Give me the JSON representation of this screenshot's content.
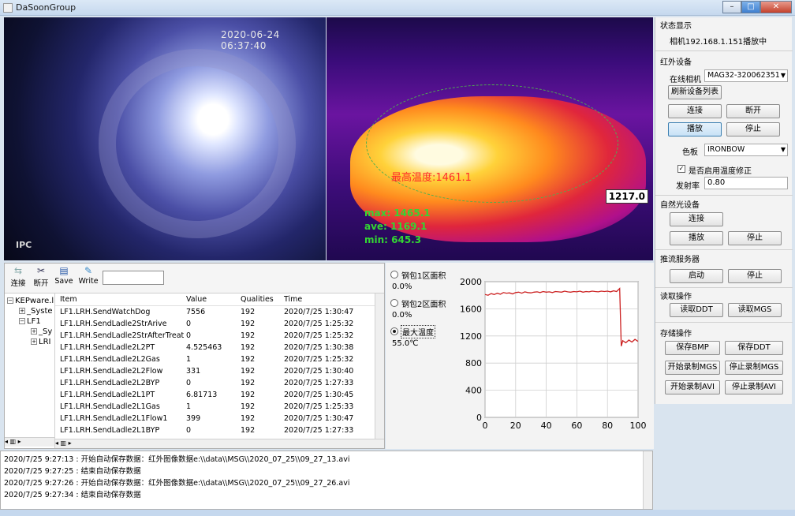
{
  "window": {
    "title": "DaSoonGroup"
  },
  "video": {
    "timestamp": "2020-06-24 06:37:40",
    "ipc_label": "IPC",
    "max_marker": "最高温度:1461.1",
    "stats_max": "max: 1465.1",
    "stats_ave": "ave: 1169.1",
    "stats_min": "min: 645.3",
    "point_temp": "1217.0"
  },
  "status": {
    "title": "状态显示",
    "text": "相机192.168.1.151播放中"
  },
  "infrared": {
    "title": "红外设备",
    "online_label": "在线相机",
    "camera_value": "MAG32-320062351",
    "refresh_label": "刷新设备列表",
    "connect_label": "连接",
    "disconnect_label": "断开",
    "play_label": "播放",
    "stop_label": "停止",
    "palette_label": "色板",
    "palette_value": "IRONBOW",
    "correction_label": "是否启用温度修正",
    "emissivity_label": "发射率",
    "emissivity_value": "0.80"
  },
  "natural": {
    "title": "自然光设备",
    "connect_label": "连接",
    "play_label": "播放",
    "stop_label": "停止"
  },
  "stream": {
    "title": "推流服务器",
    "start_label": "启动",
    "stop_label": "停止"
  },
  "read": {
    "title": "读取操作",
    "ddt_label": "读取DDT",
    "mgs_label": "读取MGS"
  },
  "store": {
    "title": "存储操作",
    "save_bmp": "保存BMP",
    "save_ddt": "保存DDT",
    "start_mgs": "开始录制MGS",
    "stop_mgs": "停止录制MGS",
    "start_avi": "开始录制AVI",
    "stop_avi": "停止录制AVI"
  },
  "toolbar": {
    "connect_label": "连接",
    "disconnect_label": "断开",
    "save_label": "Save",
    "write_label": "Write"
  },
  "tree": {
    "root": "KEPware.l",
    "system": "_Syste",
    "lf1": "LF1",
    "lf1_sys": "_Sy",
    "lf1_lr": "LRI"
  },
  "table": {
    "headers": [
      "Item",
      "Value",
      "Qualities",
      "Time"
    ],
    "rows": [
      [
        "LF1.LRH.SendWatchDog",
        "7556",
        "192",
        "2020/7/25 1:30:47"
      ],
      [
        "LF1.LRH.SendLadle2StrArive",
        "0",
        "192",
        "2020/7/25 1:25:32"
      ],
      [
        "LF1.LRH.SendLadle2StrAfterTreat",
        "0",
        "192",
        "2020/7/25 1:25:32"
      ],
      [
        "LF1.LRH.SendLadle2L2PT",
        "4.525463",
        "192",
        "2020/7/25 1:30:38"
      ],
      [
        "LF1.LRH.SendLadle2L2Gas",
        "1",
        "192",
        "2020/7/25 1:25:32"
      ],
      [
        "LF1.LRH.SendLadle2L2Flow",
        "331",
        "192",
        "2020/7/25 1:30:40"
      ],
      [
        "LF1.LRH.SendLadle2L2BYP",
        "0",
        "192",
        "2020/7/25 1:27:33"
      ],
      [
        "LF1.LRH.SendLadle2L1PT",
        "6.81713",
        "192",
        "2020/7/25 1:30:45"
      ],
      [
        "LF1.LRH.SendLadle2L1Gas",
        "1",
        "192",
        "2020/7/25 1:25:33"
      ],
      [
        "LF1.LRH.SendLadle2L1Flow1",
        "399",
        "192",
        "2020/7/25 1:30:47"
      ],
      [
        "LF1.LRH.SendLadle2L1BYP",
        "0",
        "192",
        "2020/7/25 1:27:33"
      ]
    ]
  },
  "options": {
    "area1_label": "钢包1区面积",
    "area1_value": "0.0%",
    "area2_label": "钢包2区面积",
    "area2_value": "0.0%",
    "maxtemp_label": "最大温度",
    "maxtemp_value": "55.0℃",
    "selected": "maxtemp"
  },
  "chart_data": {
    "type": "line",
    "xlim": [
      0,
      100
    ],
    "ylim": [
      0,
      2000
    ],
    "xticks": [
      "0",
      "20",
      "40",
      "60",
      "80",
      "100"
    ],
    "yticks": [
      "0",
      "400",
      "800",
      "1200",
      "1600",
      "2000"
    ],
    "grid": true,
    "color": "#cc2222",
    "x": [
      0,
      2,
      4,
      6,
      8,
      10,
      12,
      14,
      16,
      18,
      20,
      22,
      24,
      26,
      28,
      30,
      32,
      34,
      36,
      38,
      40,
      42,
      44,
      46,
      48,
      50,
      52,
      54,
      56,
      58,
      60,
      62,
      64,
      66,
      68,
      70,
      72,
      74,
      76,
      78,
      80,
      82,
      84,
      86,
      88,
      89,
      90,
      92,
      94,
      96,
      98,
      100
    ],
    "y": [
      1810,
      1800,
      1825,
      1810,
      1830,
      1815,
      1840,
      1830,
      1835,
      1820,
      1840,
      1845,
      1830,
      1850,
      1840,
      1835,
      1845,
      1850,
      1840,
      1855,
      1845,
      1850,
      1840,
      1855,
      1850,
      1845,
      1860,
      1850,
      1845,
      1855,
      1850,
      1860,
      1845,
      1855,
      1850,
      1860,
      1855,
      1850,
      1860,
      1855,
      1860,
      1850,
      1865,
      1855,
      1900,
      1050,
      1130,
      1100,
      1140,
      1110,
      1150,
      1120
    ]
  },
  "log": {
    "lines": [
      "2020/7/25 9:27:13 : 开始自动保存数据：红外图像数据e:\\\\data\\\\MSG\\\\2020_07_25\\\\09_27_13.avi",
      "2020/7/25 9:27:25 : 结束自动保存数据",
      "2020/7/25 9:27:26 : 开始自动保存数据：红外图像数据e:\\\\data\\\\MSG\\\\2020_07_25\\\\09_27_26.avi",
      "2020/7/25 9:27:34 : 结束自动保存数据"
    ]
  }
}
